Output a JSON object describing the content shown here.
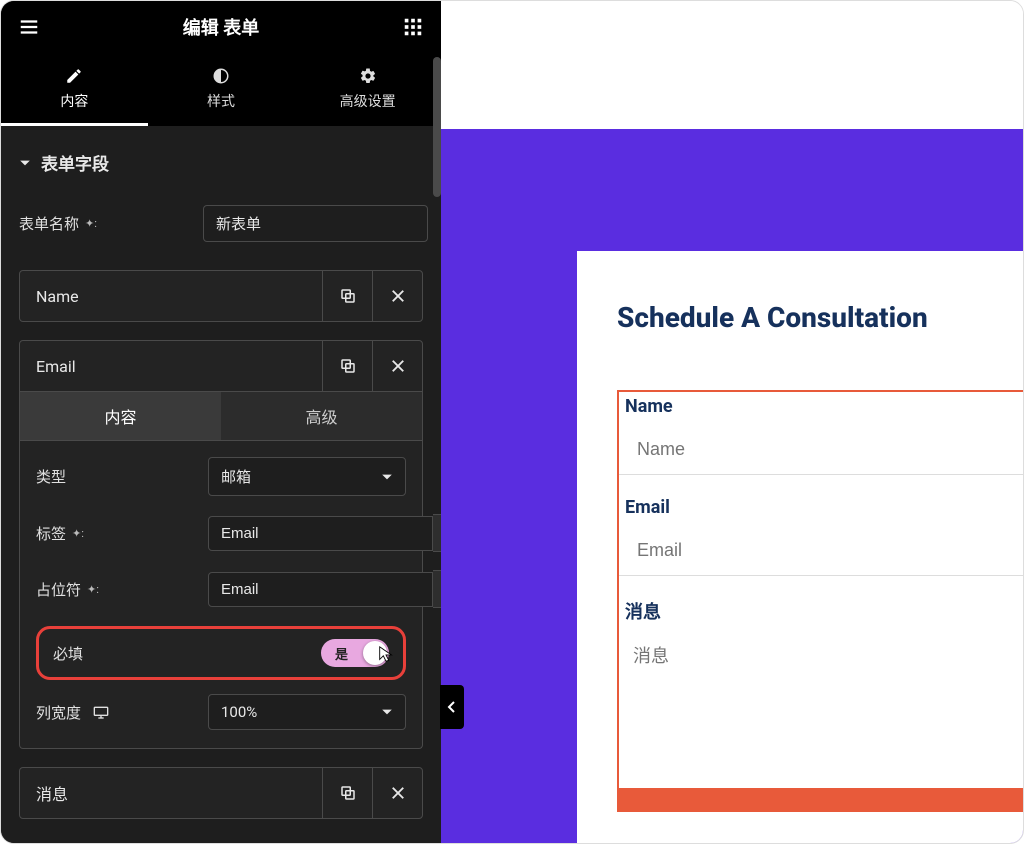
{
  "header": {
    "title": "编辑 表单"
  },
  "tabs": {
    "content": "内容",
    "style": "样式",
    "advanced": "高级设置"
  },
  "section": {
    "title": "表单字段"
  },
  "form_name": {
    "label": "表单名称",
    "value": "新表单"
  },
  "items": {
    "0": {
      "label": "Name"
    },
    "1": {
      "label": "Email"
    },
    "2": {
      "label": "消息"
    }
  },
  "subtabs": {
    "content": "内容",
    "advanced": "高级"
  },
  "detail": {
    "type_label": "类型",
    "type_value": "邮箱",
    "label_label": "标签",
    "label_value": "Email",
    "placeholder_label": "占位符",
    "placeholder_value": "Email",
    "required_label": "必填",
    "required_toggle": "是",
    "colwidth_label": "列宽度",
    "colwidth_value": "100%"
  },
  "preview": {
    "title": "Schedule A Consultation",
    "name_label": "Name",
    "name_placeholder": "Name",
    "email_label": "Email",
    "email_placeholder": "Email",
    "message_label": "消息",
    "message_placeholder": "消息"
  }
}
